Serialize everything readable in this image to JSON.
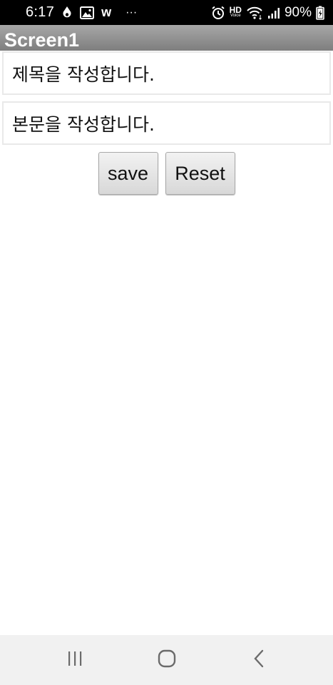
{
  "status_bar": {
    "time": "6:17",
    "battery_percent": "90%",
    "hd_label": "HD",
    "voice_label": "Voice",
    "w_label": "w",
    "more_label": "···",
    "icons": [
      "location-drop-icon",
      "gallery-icon",
      "w-app-icon",
      "more-dots-icon",
      "alarm-icon",
      "hd-voice-icon",
      "wifi-icon",
      "signal-icon",
      "battery-charging-icon"
    ]
  },
  "title_bar": {
    "title": "Screen1"
  },
  "form": {
    "title_field_value": "제목을 작성합니다.",
    "body_field_value": "본문을 작성합니다."
  },
  "buttons": {
    "save_label": "save",
    "reset_label": "Reset"
  },
  "nav_bar": {
    "icons": [
      "recent-apps-icon",
      "home-icon",
      "back-icon"
    ]
  },
  "colors": {
    "status_bar_bg": "#000000",
    "title_bar_gradient_top": "#a7a7a7",
    "title_bar_gradient_bottom": "#7e7e7e",
    "nav_bar_bg": "#f1f1f1",
    "button_gradient_top": "#f2f2f2",
    "button_gradient_bottom": "#d8d8d8"
  }
}
